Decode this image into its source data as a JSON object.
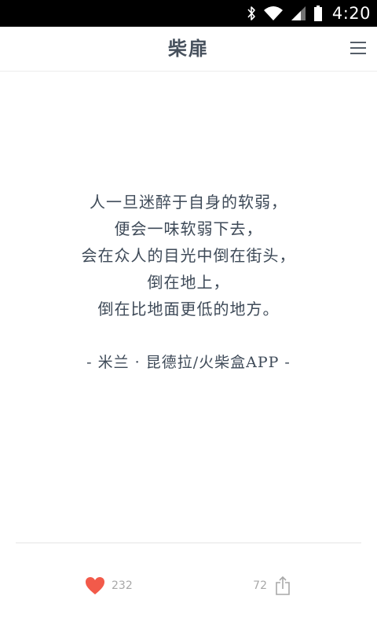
{
  "status_bar": {
    "time": "4:20"
  },
  "header": {
    "title": "柴扉"
  },
  "quote": {
    "lines": [
      "人一旦迷醉于自身的软弱，",
      "便会一味软弱下去，",
      "会在众人的目光中倒在街头，",
      "倒在地上，",
      "倒在比地面更低的地方。"
    ],
    "attribution": "- 米兰 · 昆德拉/火柴盒APP -"
  },
  "actions": {
    "like_count": "232",
    "share_count": "72"
  },
  "colors": {
    "text": "#3e4a58",
    "heart": "#f25a4a",
    "muted": "#a8a8a8"
  }
}
